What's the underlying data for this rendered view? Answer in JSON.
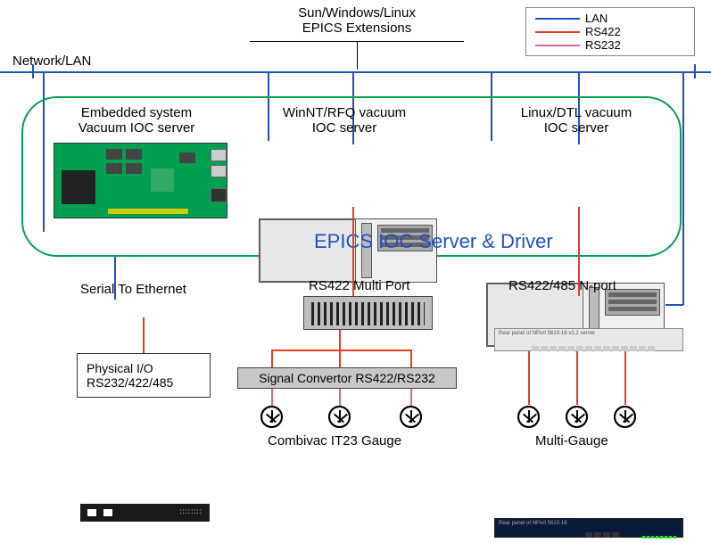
{
  "header": {
    "title_line1": "Sun/Windows/Linux",
    "title_line2": "EPICS Extensions",
    "network_label": "Network/LAN"
  },
  "legend": {
    "lan": "LAN",
    "rs422": "RS422",
    "rs232": "RS232"
  },
  "servers": {
    "embedded": {
      "line1": "Embedded system",
      "line2": "Vacuum IOC server"
    },
    "winnt": {
      "line1": "WinNT/RFQ vacuum",
      "line2": "IOC server"
    },
    "linux": {
      "line1": "Linux/DTL vacuum",
      "line2": "IOC server"
    }
  },
  "section_title": "EPICS IOC Server & Driver",
  "serial": {
    "label": "Serial To Ethernet",
    "physical_line1": "Physical I/O",
    "physical_line2": "RS232/422/485"
  },
  "rs422": {
    "multiport_label": "RS422 Multi Port",
    "signal_conv": "Signal Convertor RS422/RS232",
    "combivac": "Combivac IT23 Gauge"
  },
  "nport": {
    "label": "RS422/485 N-port",
    "multigauge": "Multi-Gauge"
  }
}
